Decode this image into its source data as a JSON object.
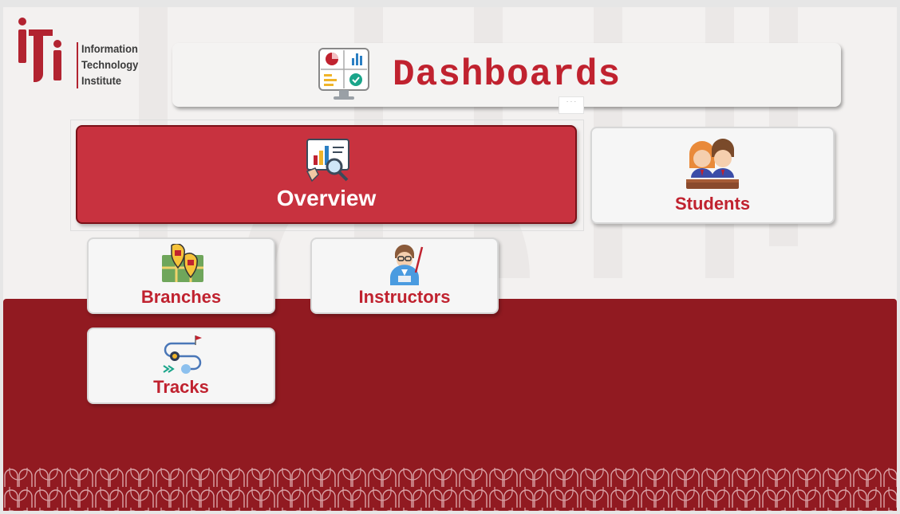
{
  "brand": {
    "line1": "Information",
    "line2": "Technology",
    "line3": "Institute",
    "accent": "#c0222f",
    "band": "#911a21"
  },
  "header": {
    "title": "Dashboards",
    "tab_marker": "· · ·"
  },
  "nav": {
    "overview": {
      "label": "Overview",
      "icon": "analytics-magnifier-icon",
      "selected": true
    },
    "students": {
      "label": "Students",
      "icon": "students-icon"
    },
    "branches": {
      "label": "Branches",
      "icon": "branches-map-icon"
    },
    "instructors": {
      "label": "Instructors",
      "icon": "instructor-icon"
    },
    "tracks": {
      "label": "Tracks",
      "icon": "tracks-roadmap-icon"
    }
  }
}
